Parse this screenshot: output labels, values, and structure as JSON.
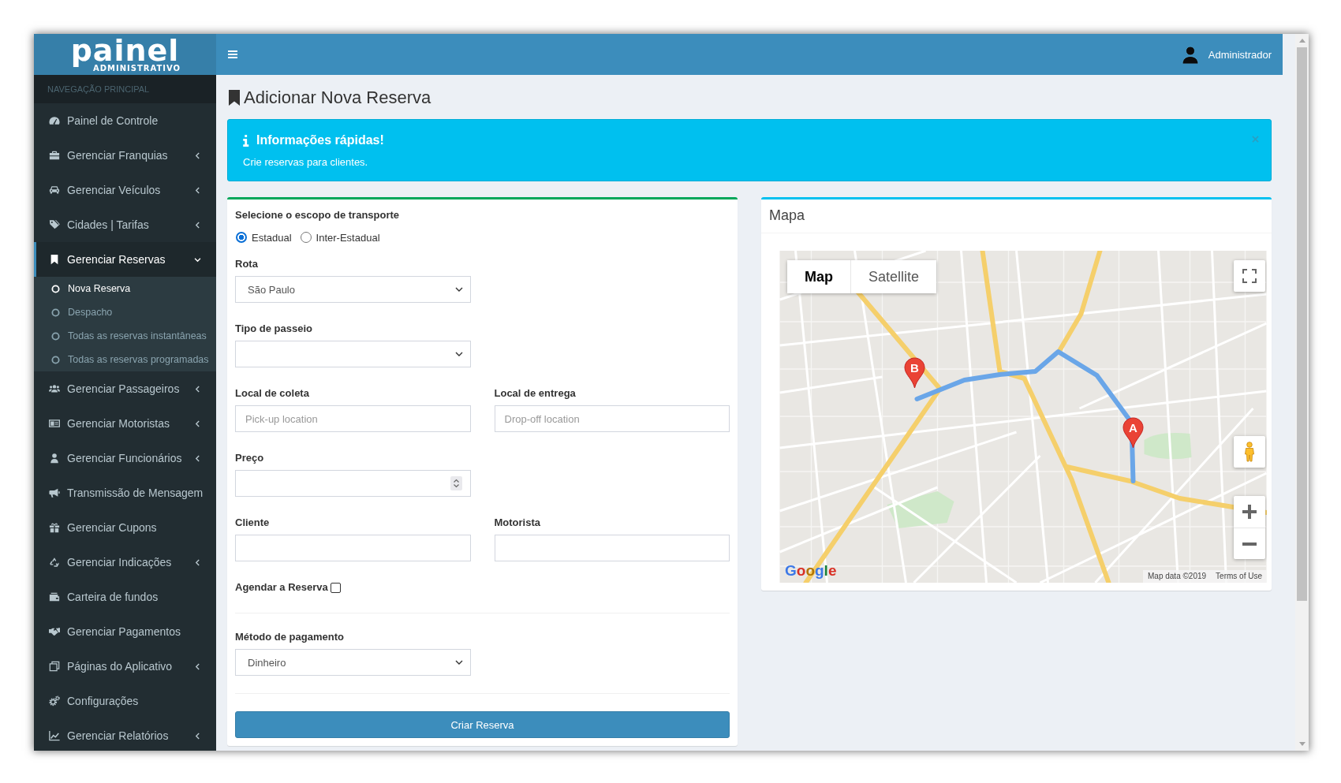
{
  "sidebar": {
    "logo": {
      "title": "painel",
      "subtitle": "ADMINISTRATIVO"
    },
    "section_header": "NAVEGAÇÃO PRINCIPAL",
    "items": [
      {
        "label": "Painel de Controle",
        "kind": "link",
        "selected": false
      },
      {
        "label": "Gerenciar Franquias",
        "kind": "tree",
        "selected": false,
        "expanded": false
      },
      {
        "label": "Gerenciar Veículos",
        "kind": "tree",
        "selected": false,
        "expanded": false
      },
      {
        "label": "Cidades | Tarifas",
        "kind": "tree",
        "selected": false,
        "expanded": false
      },
      {
        "label": "Gerenciar Reservas",
        "kind": "tree",
        "selected": true,
        "expanded": true,
        "children": [
          {
            "label": "Nova Reserva",
            "selected": true
          },
          {
            "label": "Despacho",
            "selected": false
          },
          {
            "label": "Todas as reservas instantâneas",
            "selected": false
          },
          {
            "label": "Todas as reservas programadas",
            "selected": false
          }
        ]
      },
      {
        "label": "Gerenciar Passageiros",
        "kind": "tree",
        "selected": false,
        "expanded": false
      },
      {
        "label": "Gerenciar Motoristas",
        "kind": "tree",
        "selected": false,
        "expanded": false
      },
      {
        "label": "Gerenciar Funcionários",
        "kind": "tree",
        "selected": false,
        "expanded": false
      },
      {
        "label": "Transmissão de Mensagem",
        "kind": "link",
        "selected": false
      },
      {
        "label": "Gerenciar Cupons",
        "kind": "link",
        "selected": false
      },
      {
        "label": "Gerenciar Indicações",
        "kind": "tree",
        "selected": false,
        "expanded": false
      },
      {
        "label": "Carteira de fundos",
        "kind": "link",
        "selected": false
      },
      {
        "label": "Gerenciar Pagamentos",
        "kind": "link",
        "selected": false
      },
      {
        "label": "Páginas do Aplicativo",
        "kind": "tree",
        "selected": false,
        "expanded": false
      },
      {
        "label": "Configurações",
        "kind": "link",
        "selected": false
      },
      {
        "label": "Gerenciar Relatórios",
        "kind": "tree",
        "selected": false,
        "expanded": false
      }
    ]
  },
  "header": {
    "user": "Administrador"
  },
  "page": {
    "title": "Adicionar Nova Reserva"
  },
  "alert": {
    "title": "Informações rápidas!",
    "message": "Crie reservas para clientes.",
    "dismissible": true
  },
  "form": {
    "scope": {
      "label": "Selecione o escopo de transporte",
      "options": [
        {
          "label": "Estadual",
          "selected": true
        },
        {
          "label": "Inter-Estadual",
          "selected": false
        }
      ]
    },
    "rows": [
      {
        "fields": [
          {
            "kind": "select",
            "label": "Rota",
            "value": "São Paulo"
          }
        ]
      },
      {
        "fields": [
          {
            "kind": "select",
            "label": "Tipo de passeio"
          }
        ]
      },
      {
        "fields": [
          {
            "kind": "text",
            "label": "Local de coleta",
            "placeholder": "Pick-up location"
          },
          {
            "kind": "text",
            "label": "Local de entrega",
            "placeholder": "Drop-off location"
          }
        ]
      },
      {
        "fields": [
          {
            "kind": "number",
            "label": "Preço"
          }
        ]
      },
      {
        "fields": [
          {
            "kind": "text",
            "label": "Cliente"
          },
          {
            "kind": "text",
            "label": "Motorista"
          }
        ]
      },
      {
        "fields": [
          {
            "kind": "checkbox",
            "label": "Agendar a Reserva",
            "checked": false
          }
        ]
      }
    ],
    "payment": {
      "kind": "select",
      "label": "Método de pagamento",
      "value": "Dinheiro"
    },
    "submit": "Criar Reserva"
  },
  "map_panel": {
    "title": "Mapa",
    "map_types": [
      {
        "label": "Map",
        "selected": true
      },
      {
        "label": "Satellite",
        "selected": false
      }
    ],
    "markers": [
      {
        "label": "B"
      },
      {
        "label": "A"
      }
    ],
    "logo": "Google",
    "attribution": "Map data ©2019",
    "terms": "Terms of Use"
  }
}
